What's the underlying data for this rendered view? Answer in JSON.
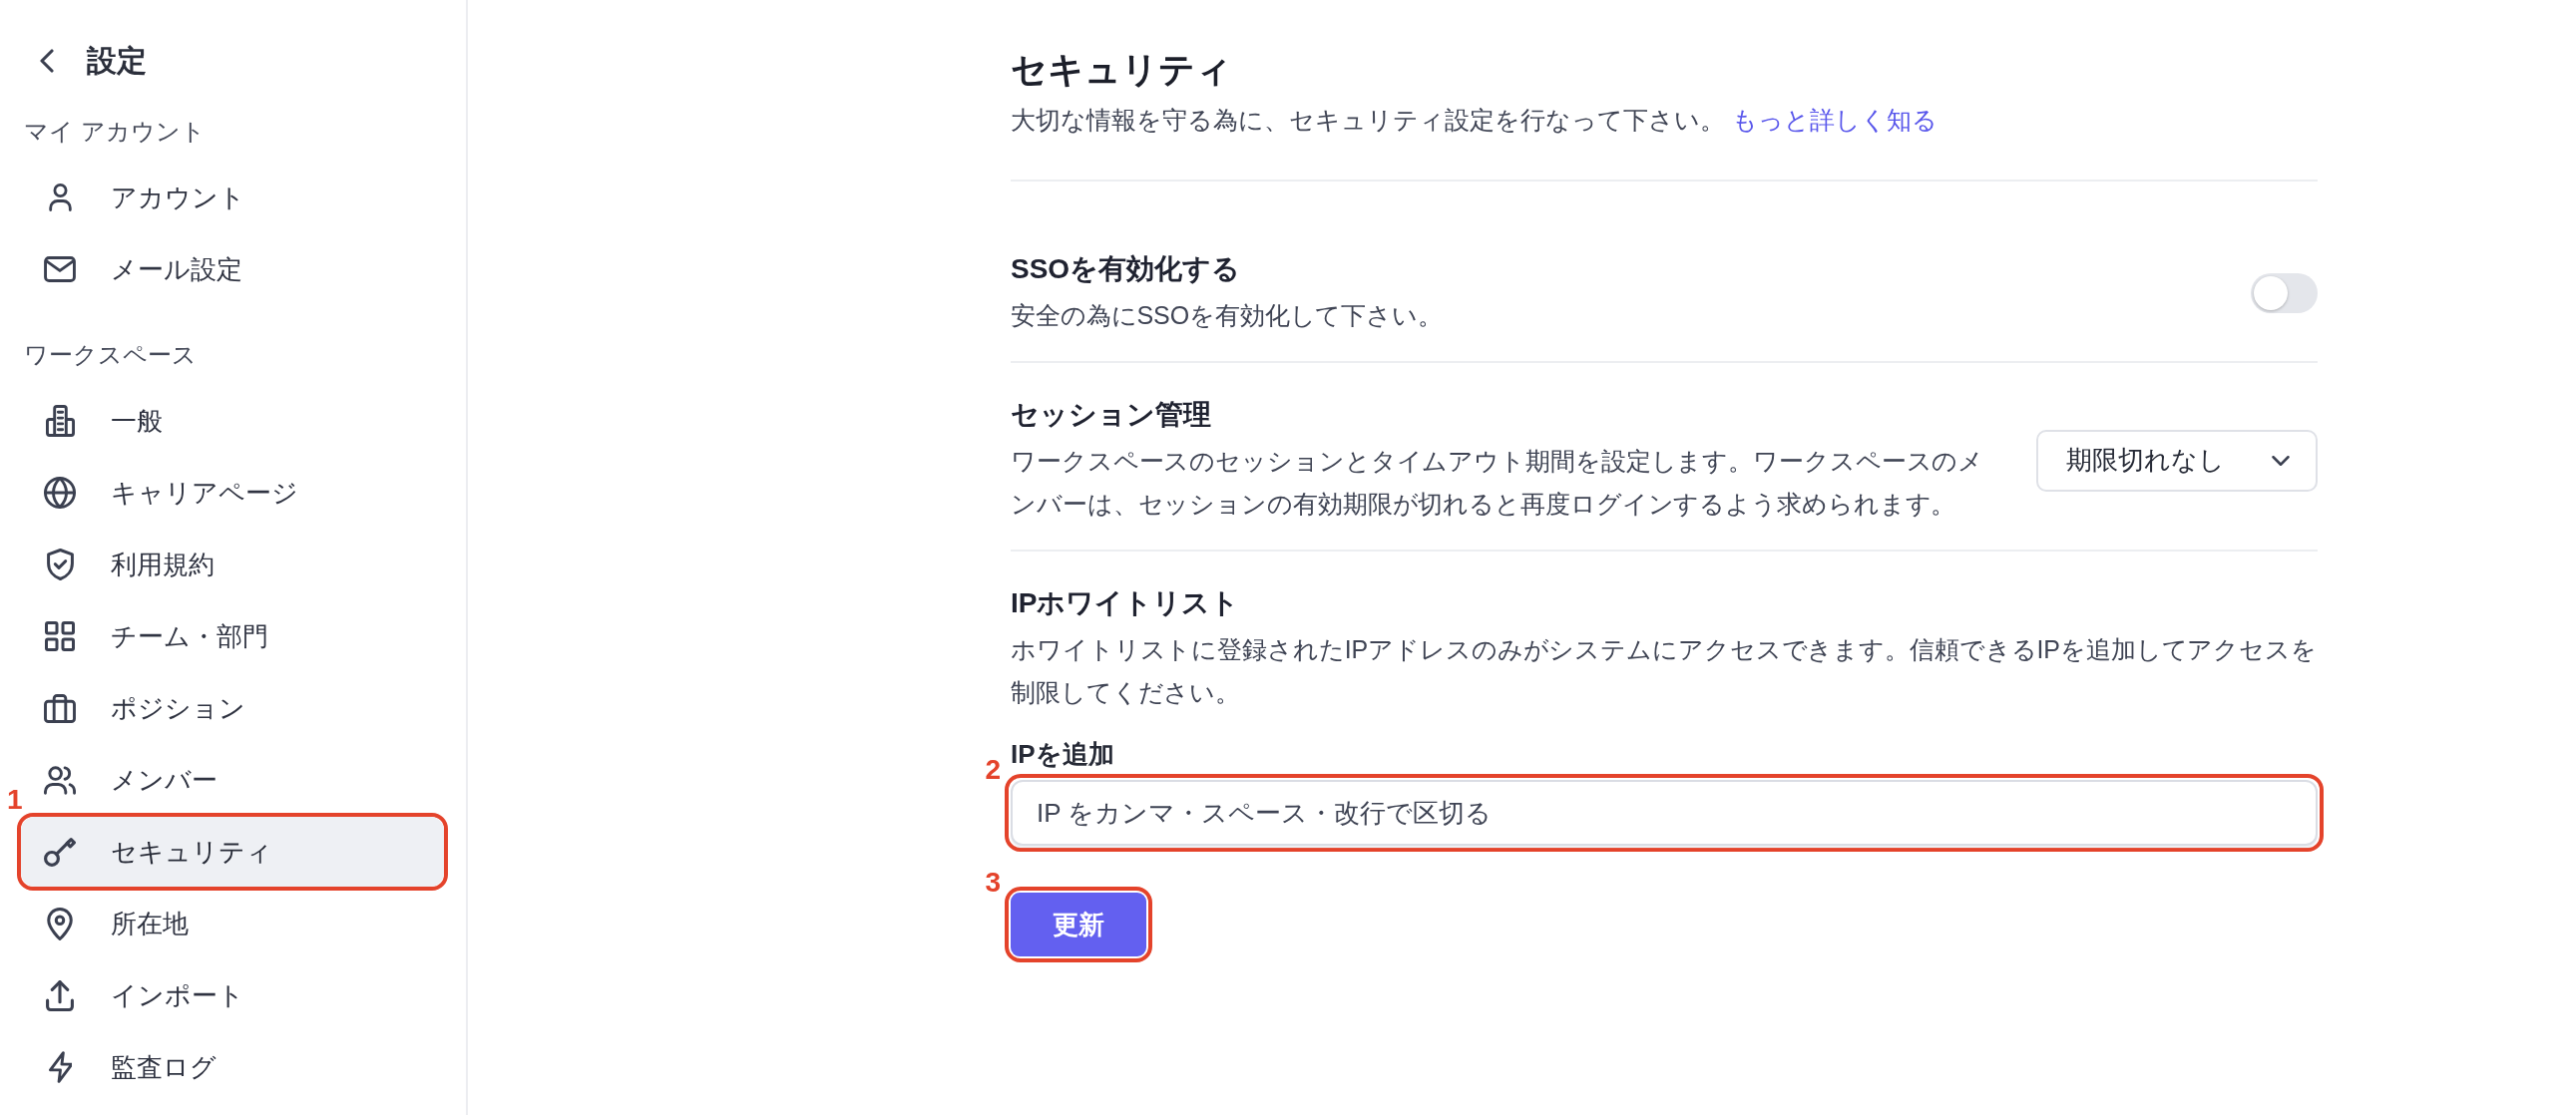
{
  "sidebar": {
    "title": "設定",
    "sections": [
      {
        "heading": "マイ アカウント",
        "items": [
          {
            "label": "アカウント",
            "selected": false
          },
          {
            "label": "メール設定",
            "selected": false
          }
        ]
      },
      {
        "heading": "ワークスペース",
        "items": [
          {
            "label": "一般",
            "selected": false
          },
          {
            "label": "キャリアページ",
            "selected": false
          },
          {
            "label": "利用規約",
            "selected": false
          },
          {
            "label": "チーム・部門",
            "selected": false
          },
          {
            "label": "ポジション",
            "selected": false
          },
          {
            "label": "メンバー",
            "selected": false
          },
          {
            "label": "セキュリティ",
            "selected": true,
            "callout": "1"
          },
          {
            "label": "所在地",
            "selected": false
          },
          {
            "label": "インポート",
            "selected": false
          },
          {
            "label": "監査ログ",
            "selected": false
          }
        ]
      }
    ]
  },
  "page": {
    "title": "セキュリティ",
    "description": "大切な情報を守る為に、セキュリティ設定を行なって下さい。",
    "link": "もっと詳しく知る"
  },
  "settings": [
    {
      "kind": "toggle",
      "title": "SSOを有効化する",
      "description": "安全の為にSSOを有効化して下さい。",
      "on": false
    },
    {
      "kind": "select",
      "title": "セッション管理",
      "description": "ワークスペースのセッションとタイムアウト期間を設定します。ワークスペースのメンバーは、セッションの有効期限が切れると再度ログインするよう求められます。",
      "value": "期限切れなし"
    },
    {
      "kind": "list_input",
      "title": "IPホワイトリスト",
      "description": "ホワイトリストに登録されたIPアドレスのみがシステムにアクセスできます。信頼できるIPを追加してアクセスを制限してください。",
      "field_label": "IPを追加",
      "placeholder": "IP をカンマ・スペース・改行で区切る",
      "callout": "2"
    }
  ],
  "update_button": {
    "label": "更新",
    "callout": "3"
  }
}
